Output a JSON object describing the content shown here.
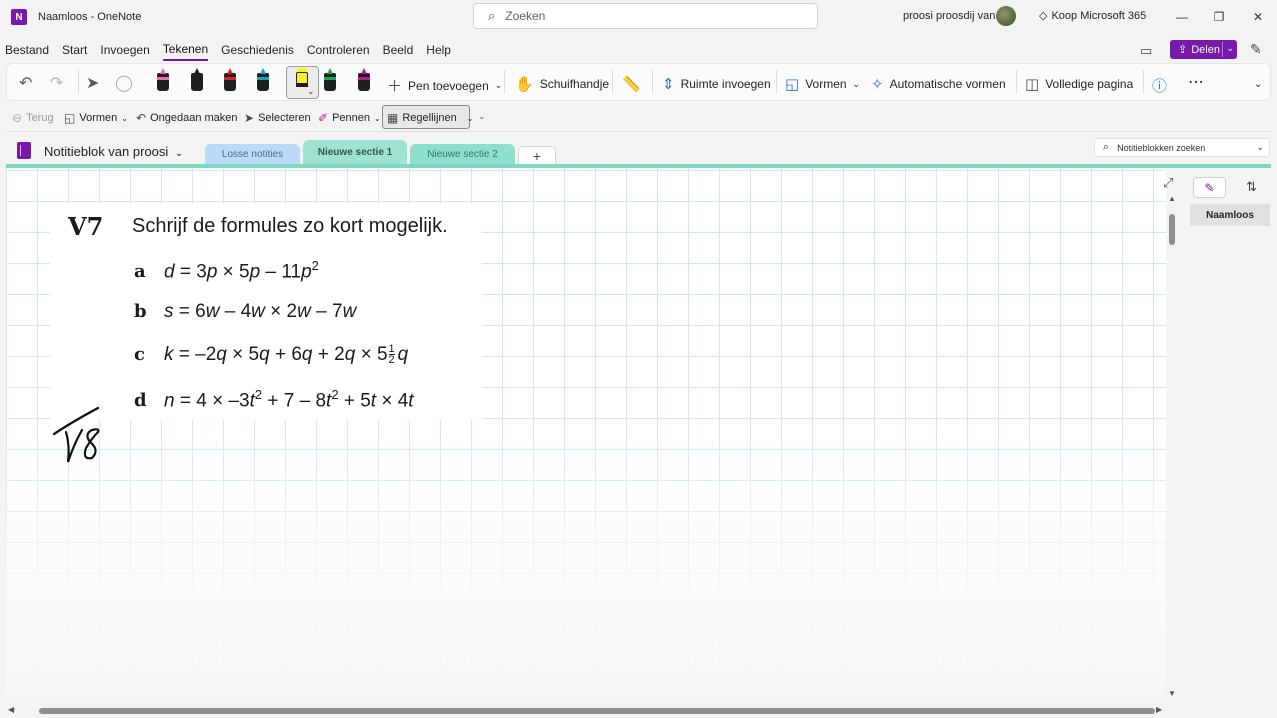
{
  "window": {
    "title": "Naamloos  -  OneNote",
    "app_logo": "N",
    "search_placeholder": "Zoeken",
    "user_name": "proosi proosdij van",
    "buy_label": "Koop Microsoft 365",
    "minimize": "—",
    "maximize": "❐",
    "close": "✕"
  },
  "menu": {
    "items": [
      "Bestand",
      "Start",
      "Invoegen",
      "Tekenen",
      "Geschiedenis",
      "Controleren",
      "Beeld",
      "Help"
    ],
    "active": "Tekenen",
    "share_label": "Delen"
  },
  "ribbon": {
    "pens": [
      {
        "name": "pen-pink",
        "color": "#f06aa8"
      },
      {
        "name": "pen-black",
        "color": "#1f1f1f"
      },
      {
        "name": "pen-red",
        "color": "#d9262c"
      },
      {
        "name": "pen-teal",
        "color": "#1aa3c8"
      },
      {
        "name": "highlighter-yellow",
        "color": "#f5f227"
      },
      {
        "name": "pen-green",
        "color": "#21a35a"
      },
      {
        "name": "pen-purple",
        "color": "#b0198f"
      }
    ],
    "add_pen": "Pen toevoegen",
    "pan": "Schuifhandje",
    "insert_space": "Ruimte invoegen",
    "shapes": "Vormen",
    "auto_shapes": "Automatische vormen",
    "full_page": "Volledige pagina"
  },
  "toolbar2": {
    "back": "Terug",
    "shapes": "Vormen",
    "undo": "Ongedaan maken",
    "select": "Selecteren",
    "pens": "Pennen",
    "rule_lines": "Regellijnen"
  },
  "notebook": {
    "name": "Notitieblok van proosi",
    "sections": [
      {
        "label": "Losse notities",
        "color": "#bcd9f7",
        "text_color": "#4a6f95"
      },
      {
        "label": "Nieuwe sectie 1",
        "color": "#9ee3cf",
        "text_color": "#2b5a4e"
      },
      {
        "label": "Nieuwe sectie 2",
        "color": "#8de0cb",
        "text_color": "#3b7a68"
      }
    ],
    "add_section": "+",
    "search_placeholder": "Notitieblokken zoeken"
  },
  "exercise": {
    "number": "V7",
    "title": "Schrijf de formules zo kort mogelijk.",
    "rows": [
      {
        "label": "a"
      },
      {
        "label": "b"
      },
      {
        "label": "c"
      },
      {
        "label": "d"
      }
    ],
    "handwritten": "V8"
  },
  "pages": {
    "items": [
      "Naamloos"
    ]
  },
  "colors": {
    "accent": "#7719aa",
    "section_accent": "#7fd8c0",
    "grid": "#cfe8f2"
  }
}
